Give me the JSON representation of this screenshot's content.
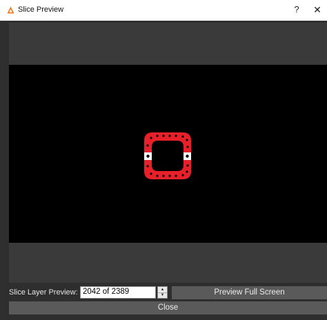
{
  "window": {
    "title": "Slice Preview",
    "help_label": "?",
    "close_label": "✕"
  },
  "controls": {
    "slice_label": "Slice Layer Preview:",
    "layer_value": "2042 of 2389",
    "fullscreen_label": "Preview Full Screen",
    "close_label": "Close"
  },
  "colors": {
    "accent": "#f07a1a",
    "slice_red": "#e8202a",
    "preview_bg": "#000000",
    "panel_bg": "#3a3a3a",
    "button_bg": "#5a5a5a"
  },
  "icons": {
    "app": "warning-triangle-icon",
    "spinner_up": "chevron-up-icon",
    "spinner_down": "chevron-down-icon"
  }
}
